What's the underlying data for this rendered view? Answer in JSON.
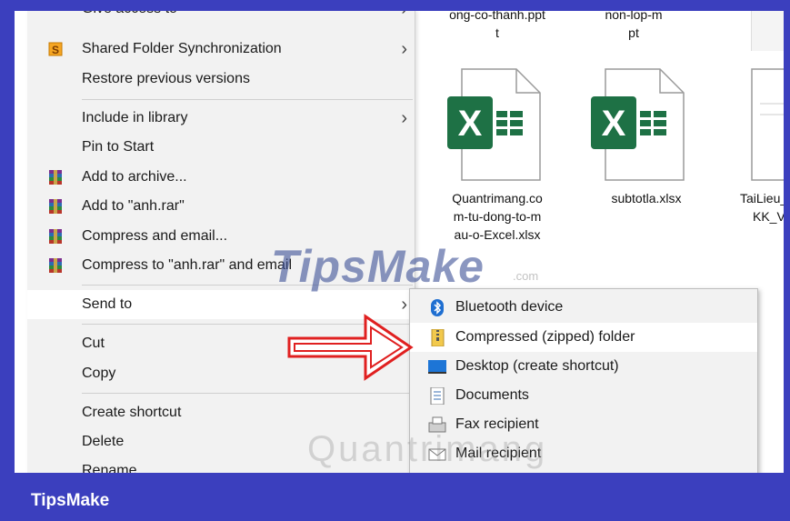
{
  "explorer": {
    "top_files": [
      {
        "line1": "ong-co-thanh.ppt",
        "line2": "t"
      },
      {
        "line1": "non-lop-m",
        "line2": "pt"
      }
    ],
    "files": [
      {
        "name_lines": [
          "Quantrimang.co",
          "m-tu-dong-to-m",
          "au-o-Excel.xlsx"
        ],
        "icon": "excel-file-icon"
      },
      {
        "name_lines": [
          "subtotla.xlsx"
        ],
        "icon": "excel-file-icon"
      },
      {
        "name_lines": [
          "TaiLieu_",
          "KK_V"
        ],
        "icon": "document-file-icon"
      }
    ]
  },
  "context_menu": {
    "items": [
      {
        "label": "Give access to",
        "arrow": "›"
      },
      {
        "label": "Shared Folder Synchronization",
        "arrow": "›",
        "icon": "sync-s-icon"
      },
      {
        "label": "Restore previous versions"
      },
      {
        "label": "Include in library",
        "arrow": "›"
      },
      {
        "label": "Pin to Start"
      },
      {
        "label": "Add to archive...",
        "icon": "winrar-icon"
      },
      {
        "label": "Add to \"anh.rar\"",
        "icon": "winrar-icon"
      },
      {
        "label": "Compress and email...",
        "icon": "winrar-icon"
      },
      {
        "label": "Compress to \"anh.rar\" and email",
        "icon": "winrar-icon"
      },
      {
        "label": "Send to",
        "arrow": "›"
      },
      {
        "label": "Cut"
      },
      {
        "label": "Copy"
      },
      {
        "label": "Create shortcut"
      },
      {
        "label": "Delete"
      },
      {
        "label": "Rename"
      }
    ]
  },
  "send_to_menu": {
    "items": [
      {
        "label": "Bluetooth device",
        "icon": "bluetooth-icon"
      },
      {
        "label": "Compressed (zipped) folder",
        "icon": "zip-folder-icon"
      },
      {
        "label": "Desktop (create shortcut)",
        "icon": "desktop-icon"
      },
      {
        "label": "Documents",
        "icon": "documents-icon"
      },
      {
        "label": "Fax recipient",
        "icon": "fax-icon"
      },
      {
        "label": "Mail recipient",
        "icon": "mail-icon"
      }
    ]
  },
  "watermark": {
    "brand": "TipsMake",
    "suffix": ".com",
    "second": "Quantrimang"
  },
  "footer": {
    "brand": "TipsMake"
  },
  "colors": {
    "frame": "#3b3fbe",
    "excel_green": "#1e7145",
    "arrow_red": "#e02020"
  }
}
